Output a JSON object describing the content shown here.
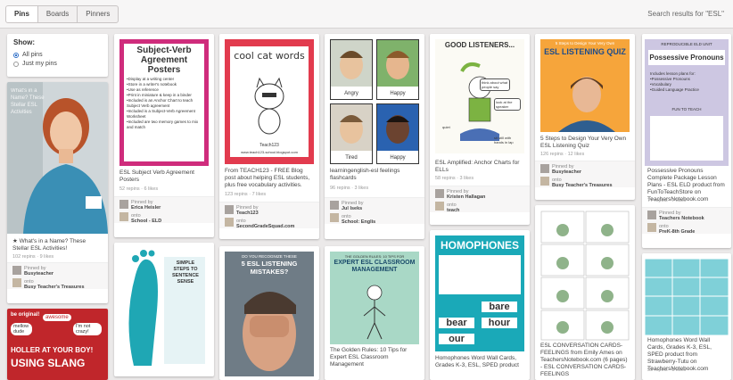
{
  "tabs": [
    {
      "label": "Pins",
      "active": true
    },
    {
      "label": "Boards",
      "active": false
    },
    {
      "label": "Pinners",
      "active": false
    }
  ],
  "search_results": "Search results for \"ESL\"",
  "filter": {
    "title": "Show:",
    "options": [
      {
        "label": "All pins",
        "selected": true
      },
      {
        "label": "Just my pins",
        "selected": false
      }
    ]
  },
  "colors": {
    "accent": "#3070c8",
    "pinterest_red": "#cb2027"
  },
  "pins": {
    "name_pin": {
      "overlay": "What's in a Name? These Stellar ESL Activities",
      "caption": "★ What's in a Name? These Stellar ESL Activities!",
      "stats": "102 repins · 9 likes",
      "pinned_by": "Pinned by",
      "pinner": "Busyteacher",
      "onto": "onto",
      "board": "Busy Teacher's Treasures"
    },
    "sva_pin": {
      "title": "Subject-Verb Agreement Posters",
      "lines": [
        "•Display at a writing center",
        "•Store in a writer's notebook",
        "•Use as reference",
        "•Print in miniature & keep in a binder",
        "•Included is an Anchor Chart to teach Subject Verb agreement",
        "•Included is a Subject-Verb Agreement Worksheet",
        "•Included are two memory games to mix and match"
      ],
      "caption": "ESL Subject Verb Agreement Posters",
      "stats": "52 repins · 6 likes",
      "pinned_by": "Pinned by",
      "pinner": "Erica Heisler",
      "onto": "onto",
      "board": "School - ELD"
    },
    "cool_pin": {
      "title": "cool cat words",
      "credit": "Teach123",
      "url": "www.teach123-school.blogspot.com",
      "caption": "From TEACH123 - FREE Blog post about helping ESL students, plus free vocabulary activities.",
      "stats": "123 repins · 7 likes",
      "pinned_by": "Pinned by",
      "pinner": "Teach123",
      "onto": "onto",
      "board": "SecondGradeSquad.com"
    },
    "feel_pin": {
      "labels": [
        "Angry",
        "Happy",
        "Tired",
        "Happy"
      ],
      "caption": "learningenglish-esl feelings flashcards",
      "stats": "96 repins · 3 likes",
      "pinned_by": "Pinned by",
      "pinner": "Jul Iseks",
      "onto": "onto",
      "board": "School: Englis"
    },
    "listen_pin": {
      "title": "GOOD LISTENERS...",
      "bubbles": [
        "think about what people say",
        "look at the speaker",
        "sit still with hands in lap",
        "quiet"
      ],
      "caption": "ESL Amplified: Anchor Charts for ELLs",
      "stats": "58 repins · 3 likes",
      "pinned_by": "Pinned by",
      "pinner": "Kristen Hallagan",
      "onto": "onto",
      "board": "teach"
    },
    "quiz_pin": {
      "banner": "5 Steps to Design Your Very Own",
      "title": "ESL LISTENING QUIZ",
      "caption": "5 Steps to Design Your Very Own ESL Listening Quiz",
      "stats": "126 repins · 12 likes",
      "pinned_by": "Pinned by",
      "pinner": "Busyteacher",
      "onto": "onto",
      "board": "Busy Teacher's Treasures"
    },
    "pron_pin": {
      "header": "REPRODUCIBLE ELD UNIT",
      "title": "Possessive Pronouns",
      "items": [
        "Includes lesson plans for:",
        "•Possessive Pronouns",
        "•Vocabulary",
        "•Guided Language Practice"
      ],
      "sub": "FUN TO TEACH",
      "caption": "Possessive Pronouns Complete Package Lesson Plans - ESL ELD product from FunToTeachStore on TeachersNotebook.com",
      "stats": "77 repins · 7 likes",
      "pinned_by": "Pinned by",
      "pinner": "Teachers Notebook",
      "onto": "onto",
      "board": "PreK-8th Grade"
    },
    "slang_pin": {
      "words": [
        "be original!",
        "Boards",
        "awesome",
        "too!",
        "mellow dude",
        "yeah",
        "I'm not crazy!"
      ],
      "title": "USING SLANG",
      "sub": "HOLLER AT YOUR BOY!"
    },
    "steps_pin": {
      "title": "SIMPLE STEPS TO SENTENCE SENSE"
    },
    "mistakes_pin": {
      "small": "DO YOU RECOGNIZE THESE",
      "title": "5 ESL LISTENING MISTAKES?"
    },
    "expert_pin": {
      "small": "THE GOLDEN RULES: 10 TIPS FOR",
      "title": "EXPERT ESL CLASSROOM MANAGEMENT",
      "caption": "The Golden Rules: 10 Tips for Expert ESL Classroom Management",
      "stats": "196 repins · 14 likes"
    },
    "homo_pin": {
      "title": "HOMOPHONES",
      "words": [
        "bear",
        "bare",
        "our",
        "hour"
      ],
      "caption": "Homophones Word Wall Cards, Grades K-3, ESL, SPED product"
    },
    "conv_pin": {
      "caption": "ESL CONVERSATION CARDS-FEELINGS from Emily Ames on TeachersNotebook.com (6 pages) - ESL CONVERSATION CARDS-FEELINGS"
    },
    "homo2_pin": {
      "caption": "Homophones Word Wall Cards, Grades K-3, ESL, SPED product from Strawberry-Tutu on TeachersNotebook.com",
      "stats": "59 repins · 8 likes"
    }
  }
}
